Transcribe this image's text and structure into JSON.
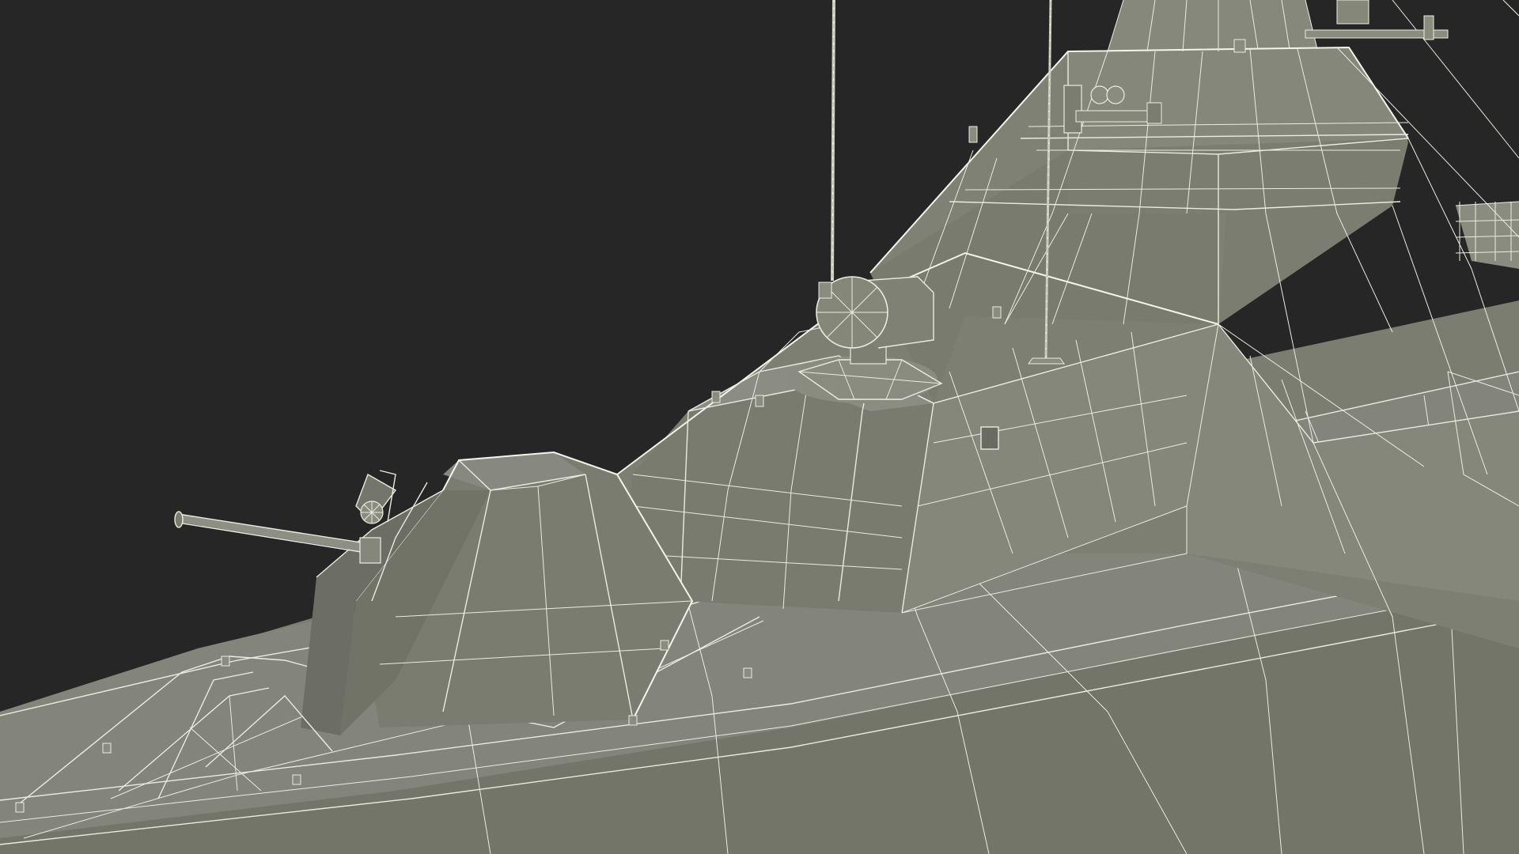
{
  "colors": {
    "background": "#262626",
    "hull": "#7d7e72",
    "hull_light": "#888a7e",
    "hull_dark": "#6b6c61",
    "wireframe": "#e9ecdf"
  }
}
